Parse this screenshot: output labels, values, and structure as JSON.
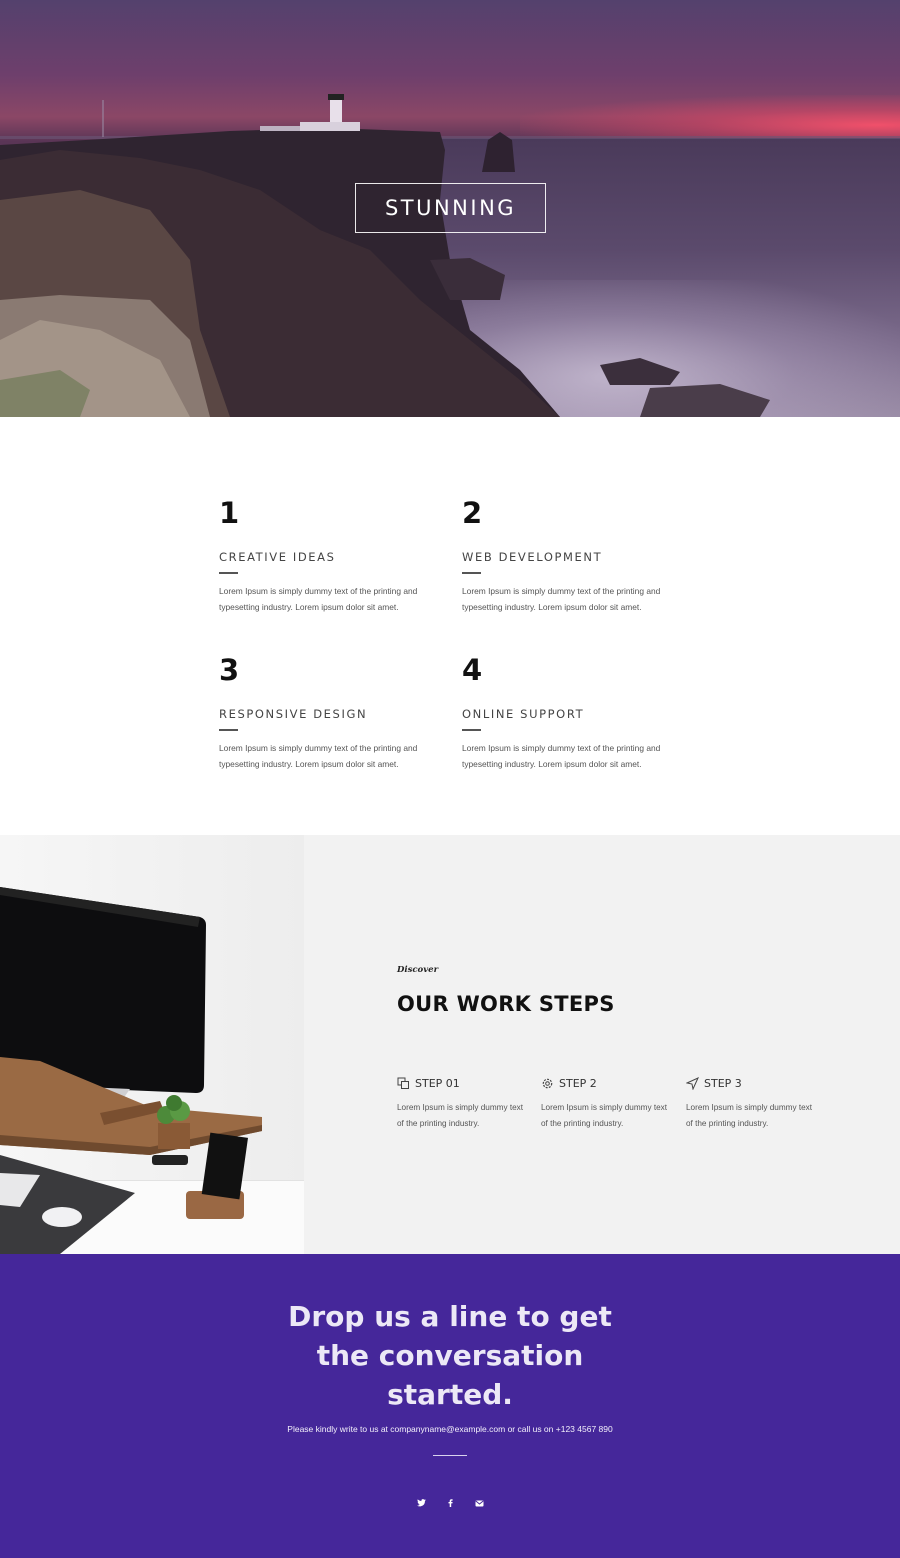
{
  "hero": {
    "title": "STUNNING"
  },
  "features": {
    "items": [
      {
        "number": "1",
        "title": "CREATIVE IDEAS",
        "description": "Lorem Ipsum is simply dummy text of the printing and typesetting industry. Lorem ipsum dolor sit amet."
      },
      {
        "number": "2",
        "title": "WEB DEVELOPMENT",
        "description": "Lorem Ipsum is simply dummy text of the printing and typesetting industry. Lorem ipsum dolor sit amet."
      },
      {
        "number": "3",
        "title": "RESPONSIVE DESIGN",
        "description": "Lorem Ipsum is simply dummy text of the printing and typesetting industry. Lorem ipsum dolor sit amet."
      },
      {
        "number": "4",
        "title": "ONLINE SUPPORT",
        "description": "Lorem Ipsum is simply dummy text of the printing and typesetting industry. Lorem ipsum dolor sit amet."
      }
    ]
  },
  "worksteps": {
    "eyebrow": "Discover",
    "heading": "OUR WORK STEPS",
    "steps": [
      {
        "icon": "copy-icon",
        "label": "STEP 01",
        "description": "Lorem Ipsum is simply dummy text of the printing industry."
      },
      {
        "icon": "gear-icon",
        "label": "STEP 2",
        "description": "Lorem Ipsum is simply dummy text of the printing industry."
      },
      {
        "icon": "send-icon",
        "label": "STEP 3",
        "description": "Lorem Ipsum is simply dummy text of the printing industry."
      }
    ]
  },
  "contact": {
    "heading_lines": [
      "Drop us a line to get",
      "the conversation",
      "started."
    ],
    "subtext": "Please kindly write to us at companyname@example.com or call us on +123 4567 890",
    "socials": [
      "twitter-icon",
      "facebook-icon",
      "mail-icon"
    ]
  },
  "colors": {
    "contact_bg": "#45279a",
    "steps_bg": "#f2f2f2",
    "heading_text": "#111111"
  }
}
